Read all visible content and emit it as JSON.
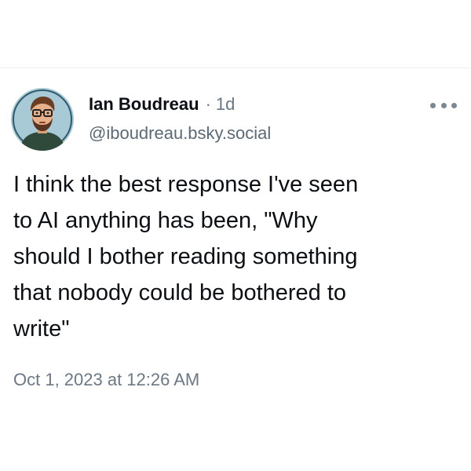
{
  "post": {
    "author": {
      "display_name": "Ian Boudreau",
      "age": "1d",
      "handle": "@iboudreau.bsky.social"
    },
    "separator": "·",
    "text": "I think the best response I've seen\nto AI anything has been, \"Why\nshould I bother reading something\nthat nobody could be bothered to\nwrite\"",
    "timestamp": "Oct 1, 2023 at 12:26 AM"
  },
  "icons": {
    "avatar": "avatar-illustration",
    "more": "more-horizontal-icon"
  },
  "colors": {
    "text": "#0b0f14",
    "muted": "#687684",
    "avatar_bg": "#a7cad6"
  }
}
